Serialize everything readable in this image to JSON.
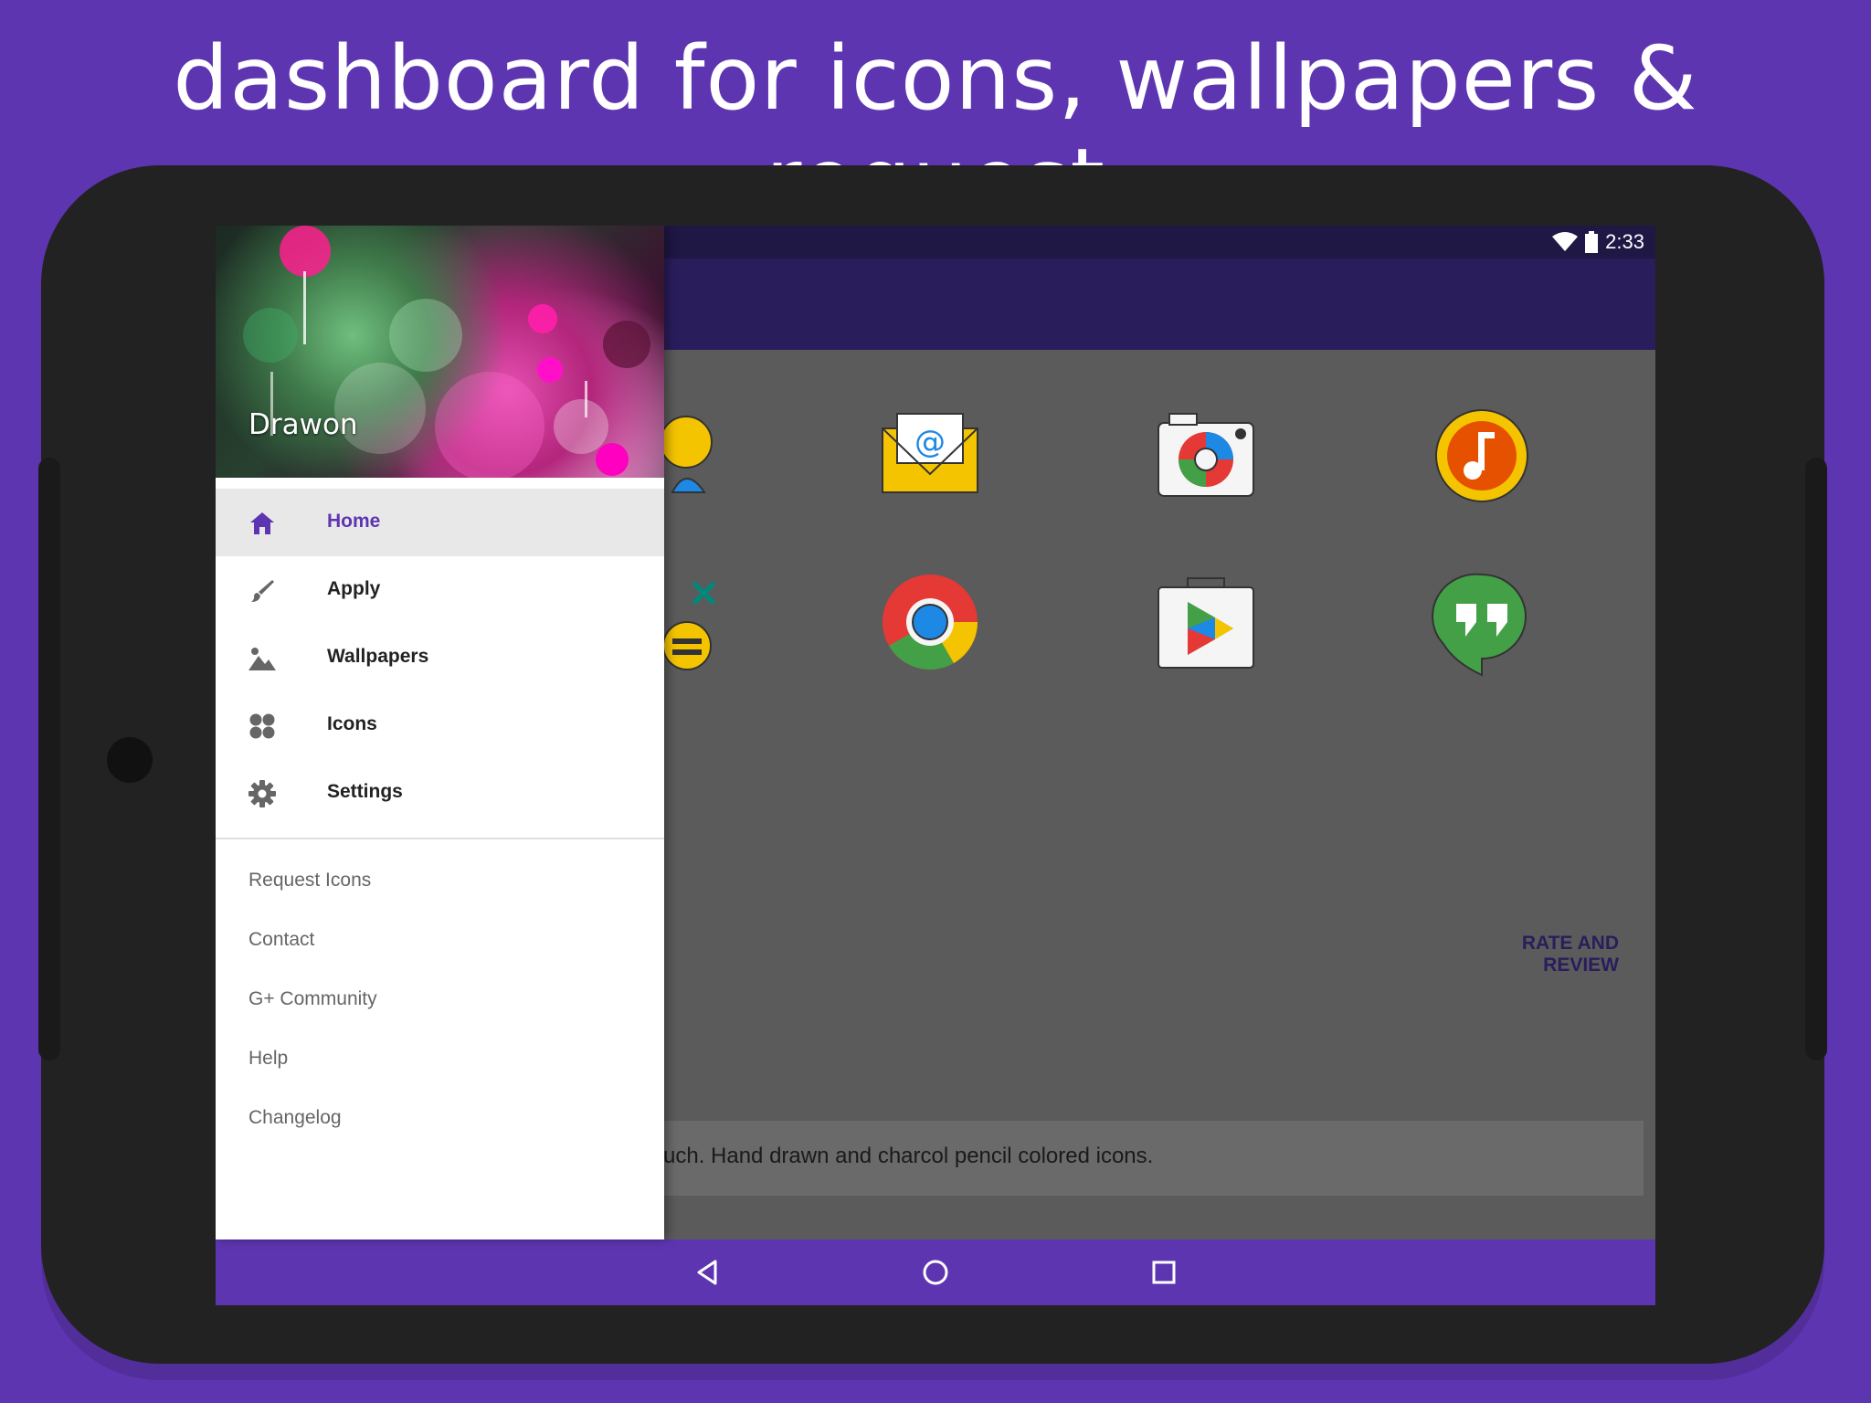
{
  "promo": {
    "title": "dashboard for icons, wallpapers & request"
  },
  "statusbar": {
    "time": "2:33"
  },
  "drawer": {
    "app_name": "Drawon",
    "primary_items": [
      {
        "label": "Home",
        "icon": "home-icon",
        "active": true
      },
      {
        "label": "Apply",
        "icon": "brush-icon",
        "active": false
      },
      {
        "label": "Wallpapers",
        "icon": "image-icon",
        "active": false
      },
      {
        "label": "Icons",
        "icon": "grid-icon",
        "active": false
      },
      {
        "label": "Settings",
        "icon": "gear-icon",
        "active": false
      }
    ],
    "secondary_items": [
      {
        "label": "Request Icons"
      },
      {
        "label": "Contact"
      },
      {
        "label": "G+ Community"
      },
      {
        "label": "Help"
      },
      {
        "label": "Changelog"
      }
    ]
  },
  "main": {
    "preview_icons": [
      "contacts-icon",
      "email-icon",
      "camera-icon",
      "music-icon",
      "calculator-icon",
      "chrome-icon",
      "play-store-icon",
      "hangouts-icon"
    ],
    "rate_button": "RATE AND REVIEW",
    "description": "uch. Hand drawn and charcol pencil colored icons."
  },
  "navbar": {
    "buttons": [
      "back-icon",
      "home-nav-icon",
      "recents-icon"
    ]
  },
  "colors": {
    "brand": "#5e35b1",
    "accent_active": "#5e35b1",
    "appbar": "#2a1d5c"
  }
}
